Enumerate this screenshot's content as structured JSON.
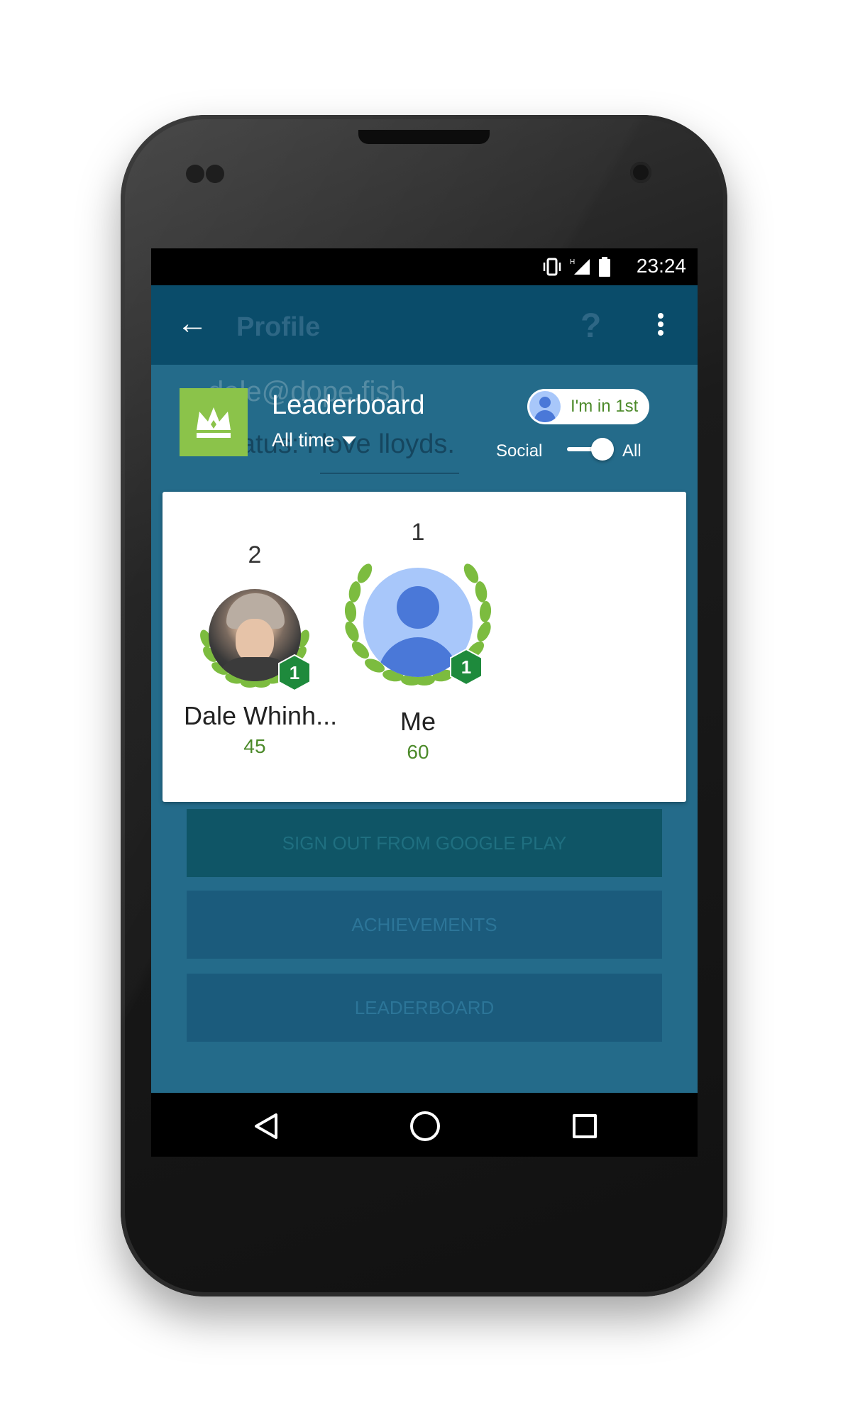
{
  "status_bar": {
    "time": "23:24",
    "icons": [
      "vibrate-icon",
      "signal-h-icon",
      "battery-icon"
    ]
  },
  "app_bar": {
    "title": "Profile",
    "help_symbol": "?"
  },
  "background_page": {
    "email_fragment": "dale@dope.fish",
    "status_text": "Status: I love lloyds.",
    "buttons": [
      "SIGN OUT FROM GOOGLE PLAY",
      "ACHIEVEMENTS",
      "LEADERBOARD"
    ]
  },
  "leaderboard": {
    "title": "Leaderboard",
    "period": "All time",
    "rank_pill": "I'm in 1st",
    "toggle": {
      "left_label": "Social",
      "right_label": "All",
      "selected": "All"
    },
    "players": [
      {
        "rank": "2",
        "name": "Dale Whinh...",
        "score": "45",
        "badge": "1"
      },
      {
        "rank": "1",
        "name": "Me",
        "score": "60",
        "badge": "1"
      }
    ]
  },
  "colors": {
    "screen_bg": "#246b8a",
    "accent_green": "#8bc34a",
    "score_green": "#4c8a2a",
    "badge_green": "#1e8a3c",
    "avatar_blue": "#4a78d8"
  }
}
